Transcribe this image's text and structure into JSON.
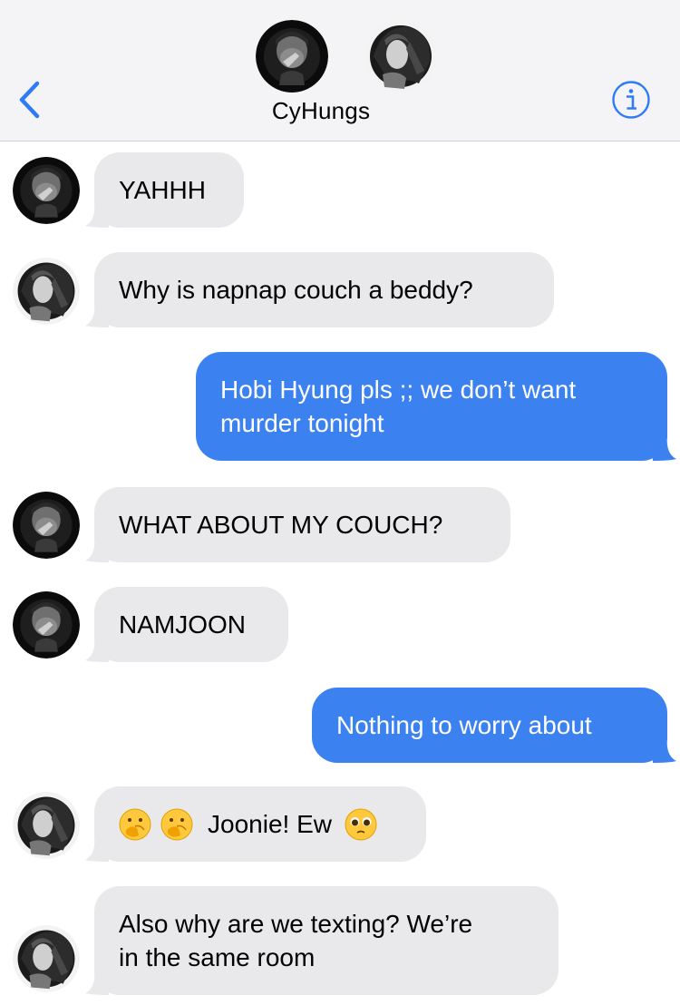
{
  "header": {
    "title": "CyHungs",
    "back_icon": "chevron-left-icon",
    "info_icon": "info-icon",
    "accent": "#2f7bf6"
  },
  "colors": {
    "incoming_bubble": "#e9e9eb",
    "outgoing_bubble": "#3b82f0",
    "header_bg": "#f4f4f6"
  },
  "messages": [
    {
      "direction": "in",
      "sender": "avatar-a",
      "text": "YAHHH"
    },
    {
      "direction": "in",
      "sender": "avatar-b",
      "text": "Why is napnap couch a beddy?"
    },
    {
      "direction": "out",
      "text": "Hobi Hyung pls ;; we don’t want\nmurder tonight"
    },
    {
      "direction": "in",
      "sender": "avatar-a",
      "text": "WHAT ABOUT MY COUCH?"
    },
    {
      "direction": "in",
      "sender": "avatar-a",
      "text": "NAMJOON"
    },
    {
      "direction": "out",
      "text": "Nothing to worry about"
    },
    {
      "direction": "in",
      "sender": "avatar-b",
      "text": "Joonie! Ew",
      "emoji_before": [
        "face-with-hand-over-mouth",
        "face-with-hand-over-mouth"
      ],
      "emoji_after": "pleading-face"
    },
    {
      "direction": "in",
      "sender": "avatar-b",
      "text": "Also why are we texting? We’re\nin the same room"
    }
  ]
}
